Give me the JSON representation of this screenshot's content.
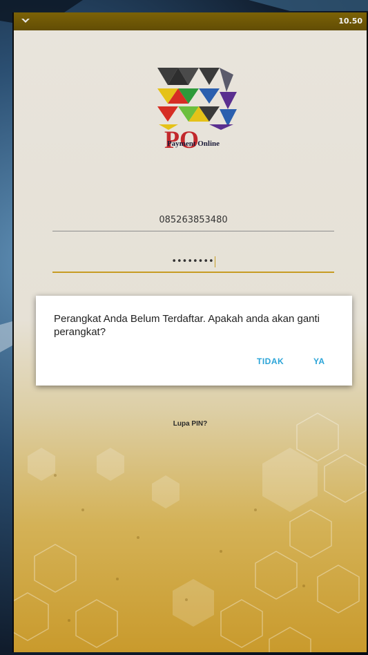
{
  "status_bar": {
    "icon": "notification-icon",
    "time": "10.50"
  },
  "logo": {
    "letters": "PO",
    "caption": "Payment Online"
  },
  "form": {
    "phone_value": "085263853480",
    "pin_value": "••••••••"
  },
  "links": {
    "forgot_pin": "Lupa PIN?"
  },
  "dialog": {
    "message": "Perangkat Anda Belum Terdaftar. Apakah anda akan ganti perangkat?",
    "negative_label": "TIDAK",
    "positive_label": "YA"
  },
  "colors": {
    "accent": "#c69c22",
    "dialog_button": "#2aa4d8",
    "status_bar": "#6e5705"
  }
}
